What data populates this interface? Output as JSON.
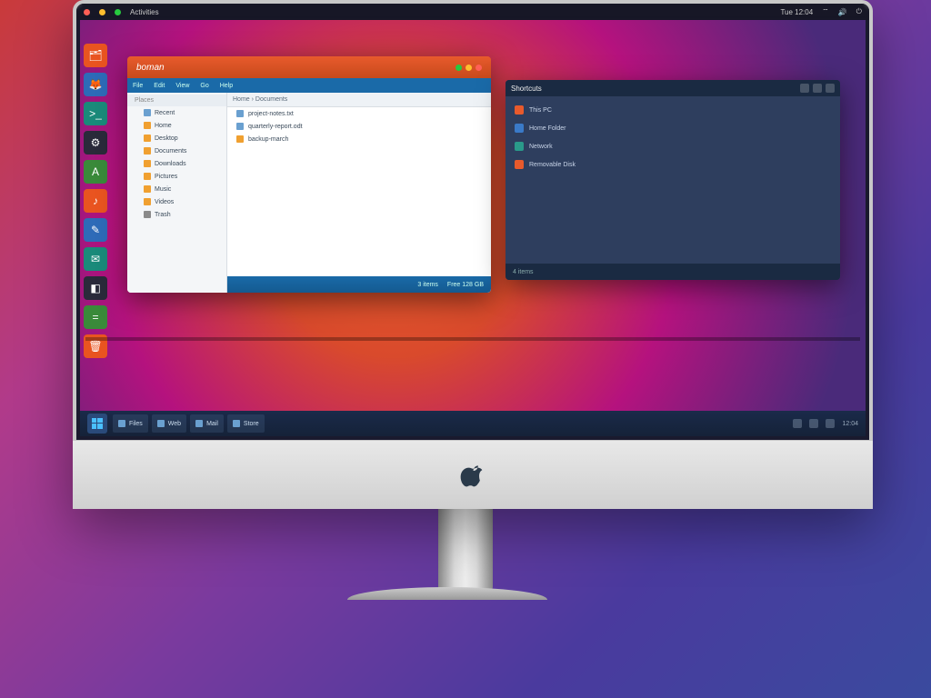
{
  "menubar": {
    "activities": "Activities",
    "clock": "Tue 12:04",
    "tray": [
      "wifi-icon",
      "volume-icon",
      "power-icon"
    ]
  },
  "launcher": {
    "items": [
      {
        "name": "files-app",
        "glyph": "🗂"
      },
      {
        "name": "firefox-app",
        "glyph": "🦊"
      },
      {
        "name": "terminal-app",
        "glyph": ">_"
      },
      {
        "name": "settings-app",
        "glyph": "⚙"
      },
      {
        "name": "store-app",
        "glyph": "A"
      },
      {
        "name": "music-app",
        "glyph": "♪"
      },
      {
        "name": "text-editor-app",
        "glyph": "✎"
      },
      {
        "name": "mail-app",
        "glyph": "✉"
      },
      {
        "name": "photos-app",
        "glyph": "◧"
      },
      {
        "name": "calc-app",
        "glyph": "="
      },
      {
        "name": "trash-app",
        "glyph": "🗑"
      }
    ]
  },
  "leftWindow": {
    "brand": "boman",
    "tabs": [
      "File",
      "Edit",
      "View",
      "Go",
      "Help"
    ],
    "breadcrumb": "Home › Documents",
    "sidebar_header": "Places",
    "sidebar": [
      {
        "label": "Recent",
        "icon": "file"
      },
      {
        "label": "Home",
        "icon": "folder"
      },
      {
        "label": "Desktop",
        "icon": "folder"
      },
      {
        "label": "Documents",
        "icon": "folder"
      },
      {
        "label": "Downloads",
        "icon": "folder"
      },
      {
        "label": "Pictures",
        "icon": "folder"
      },
      {
        "label": "Music",
        "icon": "folder"
      },
      {
        "label": "Videos",
        "icon": "folder"
      },
      {
        "label": "Trash",
        "icon": "disk"
      }
    ],
    "content": [
      {
        "label": "project-notes.txt",
        "icon": "file"
      },
      {
        "label": "quarterly-report.odt",
        "icon": "file"
      },
      {
        "label": "backup-march",
        "icon": "folder"
      }
    ],
    "footer": [
      "3 items",
      "Free 128 GB"
    ]
  },
  "rightWindow": {
    "title": "Shortcuts",
    "rows": [
      {
        "chip": "o",
        "label": "This PC"
      },
      {
        "chip": "b",
        "label": "Home Folder"
      },
      {
        "chip": "t",
        "label": "Network"
      },
      {
        "chip": "o",
        "label": "Removable Disk"
      }
    ],
    "footer_left": "4 items",
    "footer_icons": [
      "list-view-icon",
      "grid-view-icon",
      "info-icon"
    ]
  },
  "taskbar": {
    "items": [
      {
        "name": "explorer-task",
        "label": "Files"
      },
      {
        "name": "browser-task",
        "label": "Web"
      },
      {
        "name": "mail-task",
        "label": "Mail"
      },
      {
        "name": "store-task",
        "label": "Store"
      }
    ],
    "clock": "12:04"
  }
}
